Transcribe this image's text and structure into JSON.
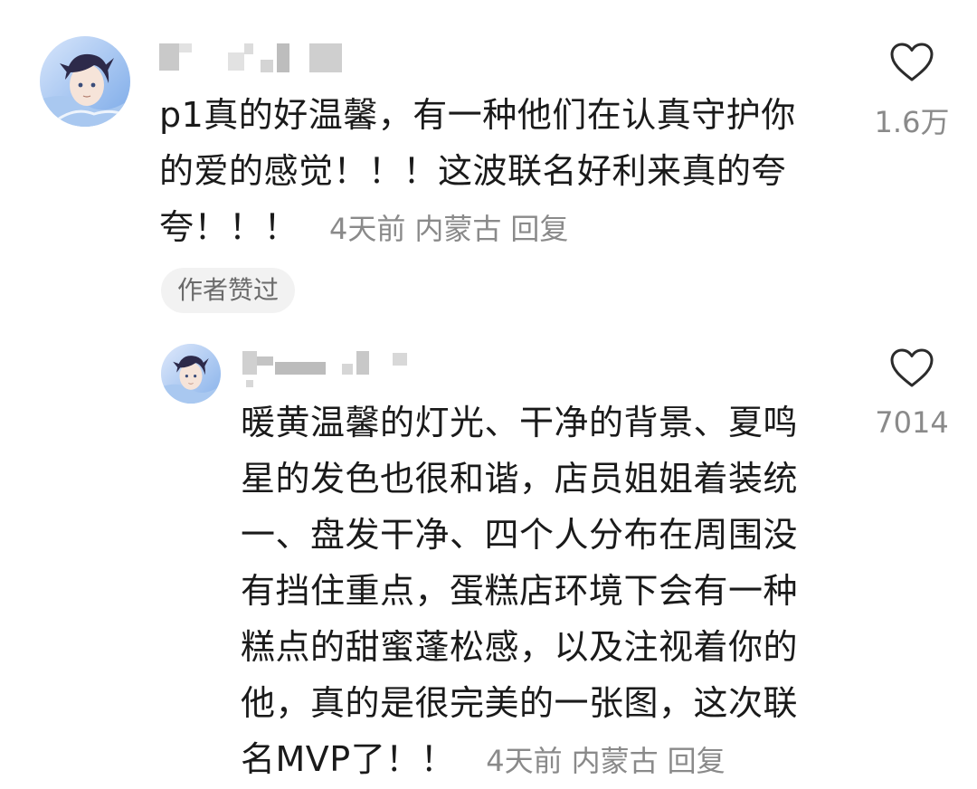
{
  "comments": [
    {
      "text": "p1真的好温馨，有一种他们在认真守护你的爱的感觉！！！这波联名好利来真的夸夸！！！",
      "time": "4天前",
      "location": "内蒙古",
      "reply_label": "回复",
      "badge": "作者赞过",
      "likes": "1.6万",
      "icons": {
        "like": "heart-outline-icon",
        "avatar": "anime-avatar"
      }
    },
    {
      "text": "暖黄温馨的灯光、干净的背景、夏鸣星的发色也很和谐，店员姐姐着装统一、盘发干净、四个人分布在周围没有挡住重点，蛋糕店环境下会有一种糕点的甜蜜蓬松感，以及注视着你的他，真的是很完美的一张图，这次联名MVP了！！",
      "time": "4天前",
      "location": "内蒙古",
      "reply_label": "回复",
      "likes": "7014",
      "icons": {
        "like": "heart-outline-icon",
        "avatar": "anime-avatar"
      }
    }
  ],
  "colors": {
    "text": "#1a1a1a",
    "meta": "#8a8a8a",
    "badge_bg": "#f2f2f2",
    "redacted_name": "#c9c9c9"
  }
}
